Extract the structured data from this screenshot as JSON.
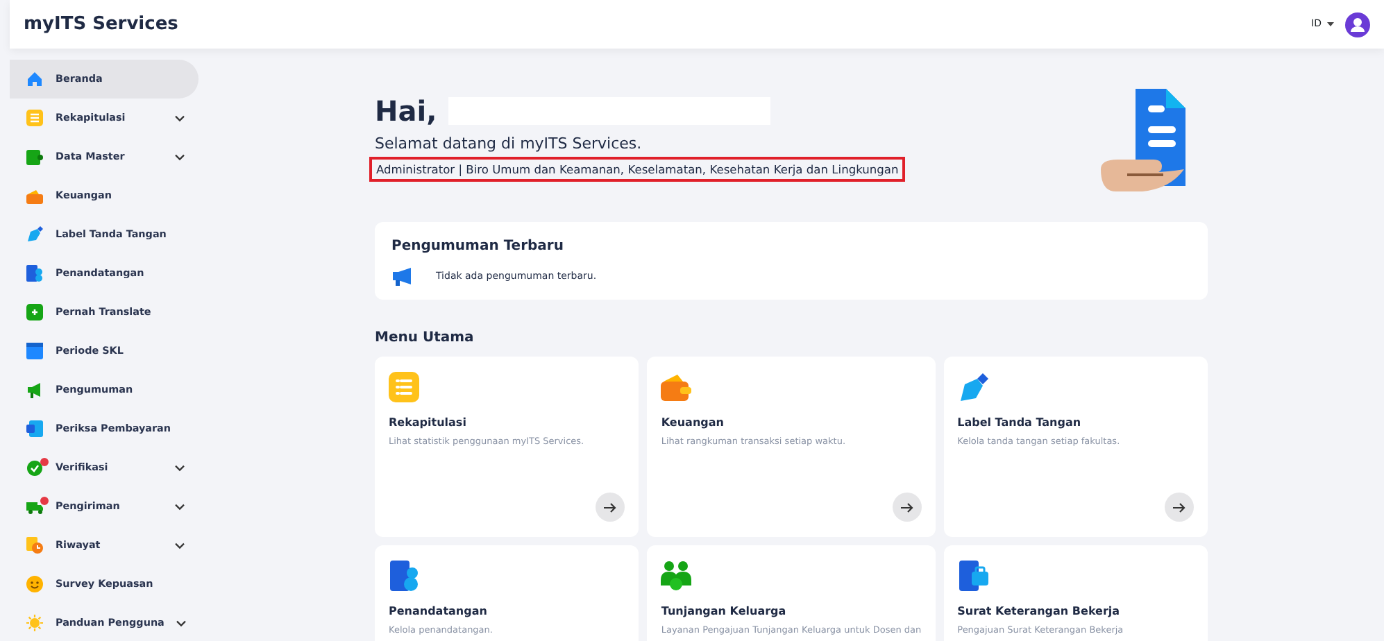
{
  "header": {
    "brand": "myITS Services",
    "language": "ID"
  },
  "sidebar": {
    "items": [
      {
        "label": "Beranda",
        "selected": true,
        "expandable": false,
        "notification": false
      },
      {
        "label": "Rekapitulasi",
        "selected": false,
        "expandable": true,
        "notification": false
      },
      {
        "label": "Data Master",
        "selected": false,
        "expandable": true,
        "notification": false
      },
      {
        "label": "Keuangan",
        "selected": false,
        "expandable": false,
        "notification": false
      },
      {
        "label": "Label Tanda Tangan",
        "selected": false,
        "expandable": false,
        "notification": false
      },
      {
        "label": "Penandatangan",
        "selected": false,
        "expandable": false,
        "notification": false
      },
      {
        "label": "Pernah Translate",
        "selected": false,
        "expandable": false,
        "notification": false
      },
      {
        "label": "Periode SKL",
        "selected": false,
        "expandable": false,
        "notification": false
      },
      {
        "label": "Pengumuman",
        "selected": false,
        "expandable": false,
        "notification": false
      },
      {
        "label": "Periksa Pembayaran",
        "selected": false,
        "expandable": false,
        "notification": false
      },
      {
        "label": "Verifikasi",
        "selected": false,
        "expandable": true,
        "notification": true
      },
      {
        "label": "Pengiriman",
        "selected": false,
        "expandable": true,
        "notification": true
      },
      {
        "label": "Riwayat",
        "selected": false,
        "expandable": true,
        "notification": false
      },
      {
        "label": "Survey Kepuasan",
        "selected": false,
        "expandable": false,
        "notification": false
      },
      {
        "label": "Panduan Pengguna",
        "selected": false,
        "expandable": true,
        "notification": false
      }
    ]
  },
  "greeting": {
    "title": "Hai,",
    "welcome": "Selamat datang di myITS Services.",
    "role": "Administrator | Biro Umum dan Keamanan, Keselamatan, Kesehatan Kerja dan Lingkungan"
  },
  "announcements": {
    "title": "Pengumuman Terbaru",
    "empty_message": "Tidak ada pengumuman terbaru."
  },
  "main_menu": {
    "title": "Menu Utama",
    "cards": [
      {
        "title": "Rekapitulasi",
        "description": "Lihat statistik penggunaan myITS Services."
      },
      {
        "title": "Keuangan",
        "description": "Lihat rangkuman transaksi setiap waktu."
      },
      {
        "title": "Label Tanda Tangan",
        "description": "Kelola tanda tangan setiap fakultas."
      },
      {
        "title": "Penandatangan",
        "description": "Kelola penandatangan."
      },
      {
        "title": "Tunjangan Keluarga",
        "description": "Layanan Pengajuan Tunjangan Keluarga untuk Dosen dan"
      },
      {
        "title": "Surat Keterangan Bekerja",
        "description": "Pengajuan Surat Keterangan Bekerja"
      }
    ]
  }
}
